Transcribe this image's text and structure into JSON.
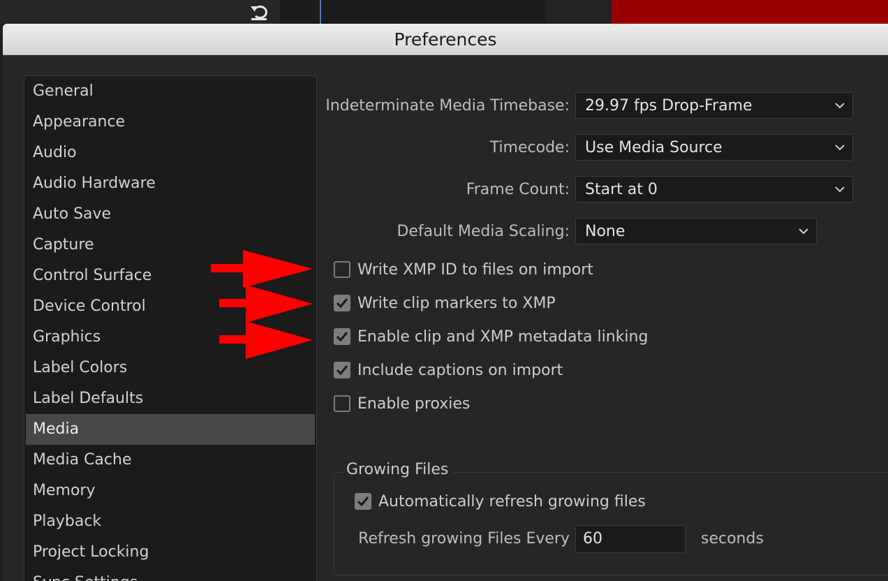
{
  "dialog": {
    "title": "Preferences"
  },
  "categories": [
    {
      "label": "General"
    },
    {
      "label": "Appearance"
    },
    {
      "label": "Audio"
    },
    {
      "label": "Audio Hardware"
    },
    {
      "label": "Auto Save"
    },
    {
      "label": "Capture"
    },
    {
      "label": "Control Surface"
    },
    {
      "label": "Device Control"
    },
    {
      "label": "Graphics"
    },
    {
      "label": "Label Colors"
    },
    {
      "label": "Label Defaults"
    },
    {
      "label": "Media",
      "selected": true
    },
    {
      "label": "Media Cache"
    },
    {
      "label": "Memory"
    },
    {
      "label": "Playback"
    },
    {
      "label": "Project Locking"
    },
    {
      "label": "Sync Settings"
    }
  ],
  "settings": {
    "timebase": {
      "label": "Indeterminate Media Timebase:",
      "value": "29.97 fps Drop-Frame"
    },
    "timecode": {
      "label": "Timecode:",
      "value": "Use Media Source"
    },
    "frame_count": {
      "label": "Frame Count:",
      "value": "Start at 0"
    },
    "scaling": {
      "label": "Default Media Scaling:",
      "value": "None"
    }
  },
  "checkboxes": [
    {
      "label": "Write XMP ID to files on import",
      "checked": false
    },
    {
      "label": "Write clip markers to XMP",
      "checked": true
    },
    {
      "label": "Enable clip and XMP metadata linking",
      "checked": true
    },
    {
      "label": "Include captions on import",
      "checked": true
    },
    {
      "label": "Enable proxies",
      "checked": false
    }
  ],
  "growing_files": {
    "title": "Growing Files",
    "auto_refresh": {
      "label": "Automatically refresh growing files",
      "checked": true
    },
    "refresh_label": "Refresh growing Files Every",
    "refresh_value": "60",
    "unit": "seconds"
  },
  "colors": {
    "annotation_arrow": "#ff0000",
    "accent_red": "#990000",
    "playhead": "#3d7bd9"
  },
  "annotations": {
    "arrow_count": 3
  }
}
